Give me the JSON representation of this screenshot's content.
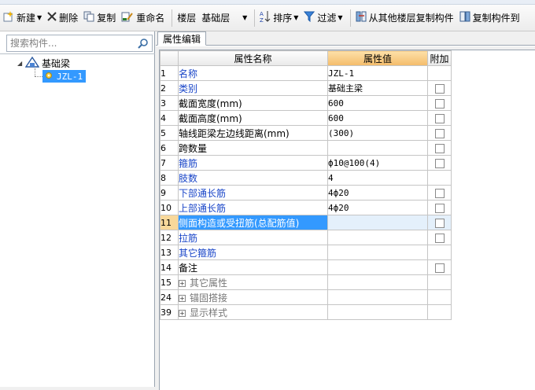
{
  "toolbar": {
    "new_label": "新建",
    "delete_label": "删除",
    "copy_label": "复制",
    "rename_label": "重命名",
    "floor_label": "楼层",
    "floor_value": "基础层",
    "sort_label": "排序",
    "filter_label": "过滤",
    "copy_from_floor_label": "从其他楼层复制构件",
    "copy_to_label": "复制构件到"
  },
  "search": {
    "placeholder": "搜索构件..."
  },
  "tree": {
    "root_label": "基础梁",
    "child_label": "JZL-1"
  },
  "tab": {
    "label": "属性编辑"
  },
  "grid": {
    "headers": {
      "name": "属性名称",
      "value": "属性值",
      "extra": "附加"
    },
    "rows": [
      {
        "idx": "1",
        "name": "名称",
        "value": "JZL-1",
        "style": "blue",
        "checkbox": false
      },
      {
        "idx": "2",
        "name": "类别",
        "value": "基础主梁",
        "style": "blue",
        "checkbox": true
      },
      {
        "idx": "3",
        "name": "截面宽度(mm)",
        "value": "600",
        "style": "black",
        "checkbox": true
      },
      {
        "idx": "4",
        "name": "截面高度(mm)",
        "value": "600",
        "style": "black",
        "checkbox": true
      },
      {
        "idx": "5",
        "name": "轴线距梁左边线距离(mm)",
        "value": "(300)",
        "style": "black",
        "checkbox": true
      },
      {
        "idx": "6",
        "name": "跨数量",
        "value": "",
        "style": "black",
        "checkbox": true
      },
      {
        "idx": "7",
        "name": "箍筋",
        "value": "ф10@100(4)",
        "style": "blue",
        "checkbox": true
      },
      {
        "idx": "8",
        "name": "肢数",
        "value": "4",
        "style": "blue",
        "checkbox": false
      },
      {
        "idx": "9",
        "name": "下部通长筋",
        "value": "4ф20",
        "style": "blue",
        "checkbox": true
      },
      {
        "idx": "10",
        "name": "上部通长筋",
        "value": "4ф20",
        "style": "blue",
        "checkbox": true
      },
      {
        "idx": "11",
        "name": "侧面构造或受扭筋(总配筋值)",
        "value": "",
        "style": "blue",
        "checkbox": true,
        "selected": true
      },
      {
        "idx": "12",
        "name": "拉筋",
        "value": "",
        "style": "blue",
        "checkbox": true
      },
      {
        "idx": "13",
        "name": "其它箍筋",
        "value": "",
        "style": "blue",
        "checkbox": false
      },
      {
        "idx": "14",
        "name": "备注",
        "value": "",
        "style": "black",
        "checkbox": true
      },
      {
        "idx": "15",
        "name": "其它属性",
        "value": "",
        "style": "gray",
        "checkbox": false,
        "group": true
      },
      {
        "idx": "24",
        "name": "锚固搭接",
        "value": "",
        "style": "gray",
        "checkbox": false,
        "group": true
      },
      {
        "idx": "39",
        "name": "显示样式",
        "value": "",
        "style": "gray",
        "checkbox": false,
        "group": true
      }
    ]
  }
}
